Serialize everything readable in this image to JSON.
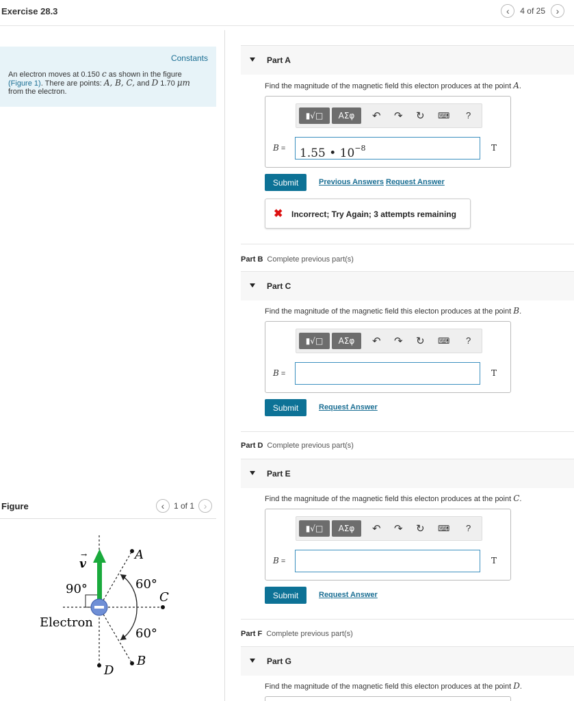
{
  "header": {
    "title": "Exercise 28.3",
    "pager_text": "4 of 25"
  },
  "constants": {
    "link": "Constants",
    "text_1": "An electron moves at 0.150 ",
    "c": "c",
    "text_2": " as shown in the figure",
    "fig_link": "(Figure 1)",
    "text_3": ". There are points: ",
    "points": "A, B, C,",
    "text_4": " and ",
    "d": "D",
    "dist": " 1.70 ",
    "unit": "μm",
    "text_5": "from the electron."
  },
  "figure": {
    "title": "Figure",
    "pager_text": "1 of 1",
    "labels": {
      "v": "v",
      "a": "A",
      "b": "B",
      "c": "C",
      "d": "D",
      "angle90": "90°",
      "angle60_top": "60°",
      "angle60_bottom": "60°",
      "electron": "Electron"
    },
    "colors": {
      "velocity_arrow": "#1aaa3c",
      "electron": "#6f8fd6"
    }
  },
  "toolbar": {
    "matrix_label": "▮√□",
    "greek_label": "ΑΣφ",
    "help": "?"
  },
  "parts": {
    "a": {
      "title": "Part A",
      "question": "Find the magnitude of the magnetic field this electon produces at the point ",
      "point": "A",
      "var": "B",
      "eq": " =",
      "value_base": "1.55 • 10",
      "value_exp": "−8",
      "unit": "T",
      "submit": "Submit",
      "prev_answers": "Previous Answers",
      "request_answer": "Request Answer",
      "feedback": "Incorrect; Try Again; 3 attempts remaining"
    },
    "b": {
      "label": "Part B",
      "note": "Complete previous part(s)"
    },
    "c": {
      "title": "Part C",
      "question": "Find the magnitude of the magnetic field this electon produces at the point ",
      "point": "B",
      "var": "B",
      "eq": " =",
      "unit": "T",
      "submit": "Submit",
      "request_answer": "Request Answer"
    },
    "d": {
      "label": "Part D",
      "note": "Complete previous part(s)"
    },
    "e": {
      "title": "Part E",
      "question": "Find the magnitude of the magnetic field this electon produces at the point ",
      "point": "C",
      "var": "B",
      "eq": " =",
      "unit": "T",
      "submit": "Submit",
      "request_answer": "Request Answer"
    },
    "f": {
      "label": "Part F",
      "note": "Complete previous part(s)"
    },
    "g": {
      "title": "Part G",
      "question": "Find the magnitude of the magnetic field this electon produces at the point ",
      "point": "D"
    }
  }
}
